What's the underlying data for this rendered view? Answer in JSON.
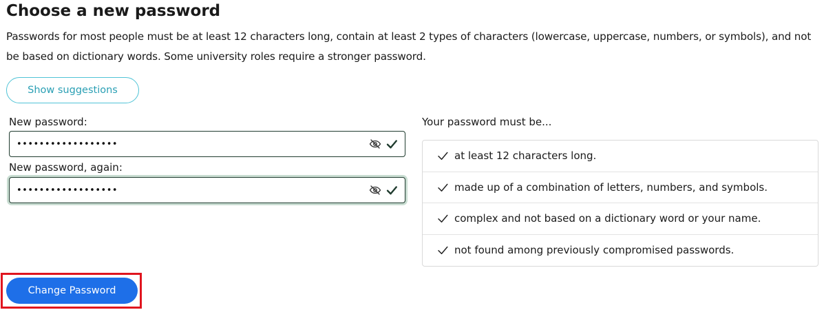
{
  "heading": "Choose a new password",
  "intro": "Passwords for most people must be at least 12 characters long, contain at least 2 types of characters (lowercase, uppercase, numbers, or symbols), and not be based on dictionary words. Some university roles require a stronger password.",
  "suggestions_button": "Show suggestions",
  "fields": {
    "new_password": {
      "label": "New password:",
      "value": "••••••••••••••••••",
      "visibility_icon": "eye-slash-icon",
      "status_icon": "check-icon"
    },
    "confirm_password": {
      "label": "New password, again:",
      "value": "••••••••••••••••••",
      "visibility_icon": "eye-slash-icon",
      "status_icon": "check-icon"
    }
  },
  "requirements": {
    "title": "Your password must be...",
    "items": [
      {
        "text": "at least 12 characters long.",
        "met": true
      },
      {
        "text": "made up of a combination of letters, numbers, and symbols.",
        "met": true
      },
      {
        "text": "complex and not based on a dictionary word or your name.",
        "met": true
      },
      {
        "text": "not found among previously compromised passwords.",
        "met": true
      }
    ]
  },
  "submit_button": "Change Password",
  "colors": {
    "primary": "#1e6fe8",
    "accent_outline": "#4fc3d6",
    "valid": "#1f3b2e",
    "highlight": "#e0141e"
  }
}
